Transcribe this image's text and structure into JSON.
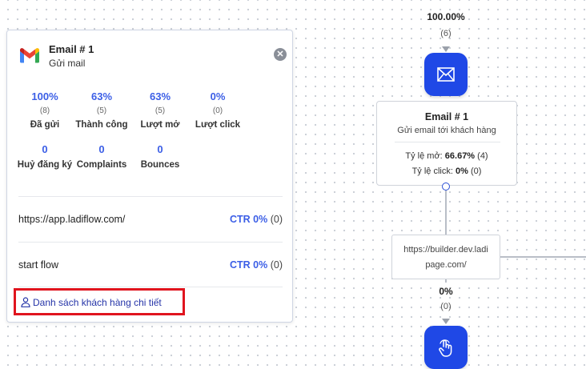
{
  "panel": {
    "title": "Email # 1",
    "subtitle": "Gửi mail",
    "close_icon": "close-icon",
    "stats_row1": [
      {
        "value": "100%",
        "count": "(8)",
        "label": "Đã gửi"
      },
      {
        "value": "63%",
        "count": "(5)",
        "label": "Thành công"
      },
      {
        "value": "63%",
        "count": "(5)",
        "label": "Lượt mở"
      },
      {
        "value": "0%",
        "count": "(0)",
        "label": "Lượt click"
      }
    ],
    "stats_row2": [
      {
        "value": "0",
        "label": "Huỷ đăng ký"
      },
      {
        "value": "0",
        "label": "Complaints"
      },
      {
        "value": "0",
        "label": "Bounces"
      }
    ],
    "links": [
      {
        "url": "https://app.ladiflow.com/",
        "ctr": "CTR 0%",
        "count": "(0)"
      },
      {
        "url": "start flow",
        "ctr": "CTR 0%",
        "count": "(0)"
      }
    ],
    "customer_list_link": "Danh sách khách hàng chi tiết",
    "accent_color": "#3b5ee6",
    "highlight_color": "#e0141e"
  },
  "flow": {
    "top_percent": "100.00%",
    "top_count": "(6)",
    "email_node": {
      "icon": "mail-icon",
      "title": "Email # 1",
      "subtitle": "Gửi email tới khách hàng",
      "open_label": "Tỷ lệ mở:",
      "open_value": "66.67%",
      "open_count": "(4)",
      "click_label": "Tỷ lệ click:",
      "click_value": "0%",
      "click_count": "(0)"
    },
    "url_node": {
      "line1": "https://builder.dev.ladi",
      "line2": "page.com/"
    },
    "bottom_percent": "0%",
    "bottom_count": "(0)",
    "bottom_node_icon": "touch-icon",
    "node_color": "#1f48e6"
  }
}
